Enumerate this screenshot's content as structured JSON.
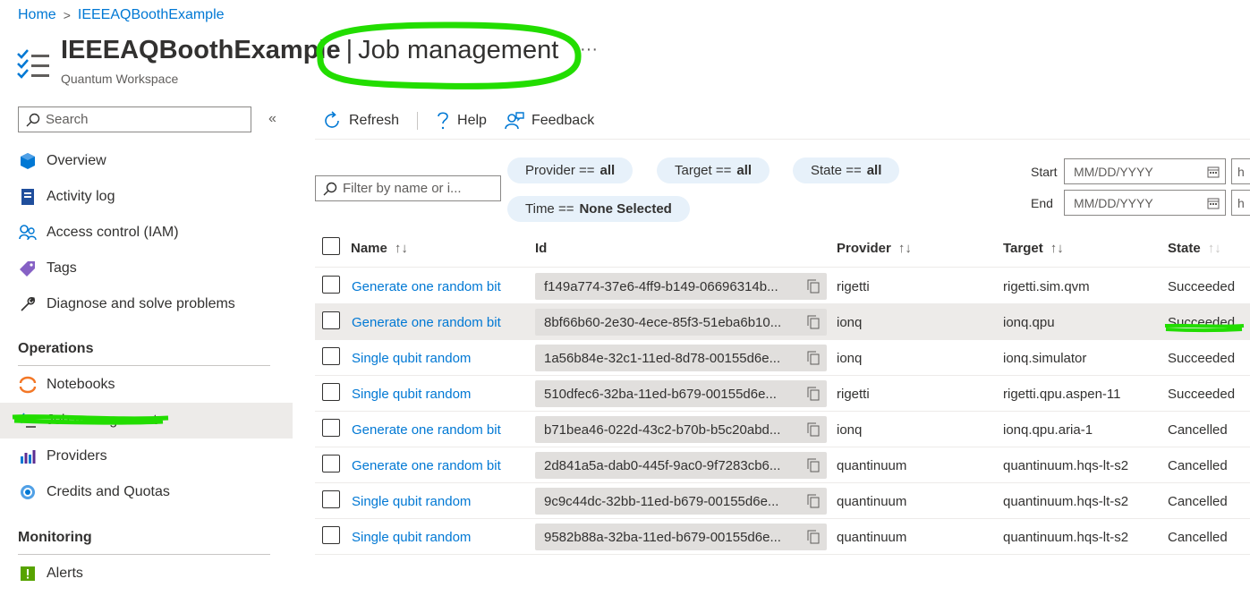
{
  "breadcrumb": {
    "home": "Home",
    "separator": ">",
    "current": "IEEEAQBoothExample"
  },
  "header": {
    "resource_name": "IEEEAQBoothExample",
    "separator": "|",
    "blade_title": "Job management",
    "more": "···",
    "subtitle": "Quantum Workspace"
  },
  "sidebar": {
    "search_placeholder": "Search",
    "collapse": "«",
    "items": [
      {
        "label": "Overview",
        "icon": "overview-icon"
      },
      {
        "label": "Activity log",
        "icon": "activity-log-icon"
      },
      {
        "label": "Access control (IAM)",
        "icon": "people-icon"
      },
      {
        "label": "Tags",
        "icon": "tag-icon"
      },
      {
        "label": "Diagnose and solve problems",
        "icon": "wrench-icon"
      }
    ],
    "sections": [
      {
        "title": "Operations",
        "items": [
          {
            "label": "Notebooks",
            "icon": "notebook-icon"
          },
          {
            "label": "Job management",
            "icon": "job-list-icon",
            "active": true
          },
          {
            "label": "Providers",
            "icon": "providers-icon"
          },
          {
            "label": "Credits and Quotas",
            "icon": "credits-icon"
          }
        ]
      },
      {
        "title": "Monitoring",
        "items": [
          {
            "label": "Alerts",
            "icon": "alert-icon"
          }
        ]
      }
    ]
  },
  "toolbar": {
    "refresh": "Refresh",
    "help": "Help",
    "feedback": "Feedback"
  },
  "filters": {
    "name_placeholder": "Filter by name or i...",
    "provider": {
      "label": "Provider ==",
      "value": "all"
    },
    "target": {
      "label": "Target ==",
      "value": "all"
    },
    "state": {
      "label": "State ==",
      "value": "all"
    },
    "time": {
      "label": "Time ==",
      "value": "None Selected"
    },
    "start_label": "Start",
    "end_label": "End",
    "date_placeholder": "MM/DD/YYYY",
    "time_placeholder_partial": "h"
  },
  "table": {
    "columns": [
      "Name",
      "Id",
      "Provider",
      "Target",
      "State"
    ],
    "sort_glyph": "↑↓",
    "rows": [
      {
        "name": "Generate one random bit",
        "id": "f149a774-37e6-4ff9-b149-06696314b...",
        "provider": "rigetti",
        "target": "rigetti.sim.qvm",
        "state": "Succeeded"
      },
      {
        "name": "Generate one random bit",
        "id": "8bf66b60-2e30-4ece-85f3-51eba6b10...",
        "provider": "ionq",
        "target": "ionq.qpu",
        "state": "Succeeded",
        "selected": true
      },
      {
        "name": "Single qubit random",
        "id": "1a56b84e-32c1-11ed-8d78-00155d6e...",
        "provider": "ionq",
        "target": "ionq.simulator",
        "state": "Succeeded"
      },
      {
        "name": "Single qubit random",
        "id": "510dfec6-32ba-11ed-b679-00155d6e...",
        "provider": "rigetti",
        "target": "rigetti.qpu.aspen-11",
        "state": "Succeeded"
      },
      {
        "name": "Generate one random bit",
        "id": "b71bea46-022d-43c2-b70b-b5c20abd...",
        "provider": "ionq",
        "target": "ionq.qpu.aria-1",
        "state": "Cancelled"
      },
      {
        "name": "Generate one random bit",
        "id": "2d841a5a-dab0-445f-9ac0-9f7283cb6...",
        "provider": "quantinuum",
        "target": "quantinuum.hqs-lt-s2",
        "state": "Cancelled"
      },
      {
        "name": "Single qubit random",
        "id": "9c9c44dc-32bb-11ed-b679-00155d6e...",
        "provider": "quantinuum",
        "target": "quantinuum.hqs-lt-s2",
        "state": "Cancelled"
      },
      {
        "name": "Single qubit random",
        "id": "9582b88a-32ba-11ed-b679-00155d6e...",
        "provider": "quantinuum",
        "target": "quantinuum.hqs-lt-s2",
        "state": "Cancelled"
      }
    ]
  },
  "colors": {
    "accent": "#0078d4",
    "highlight_marker": "#22dd00",
    "pill_bg": "#e7f1fa",
    "selected_row": "#edebe9"
  }
}
